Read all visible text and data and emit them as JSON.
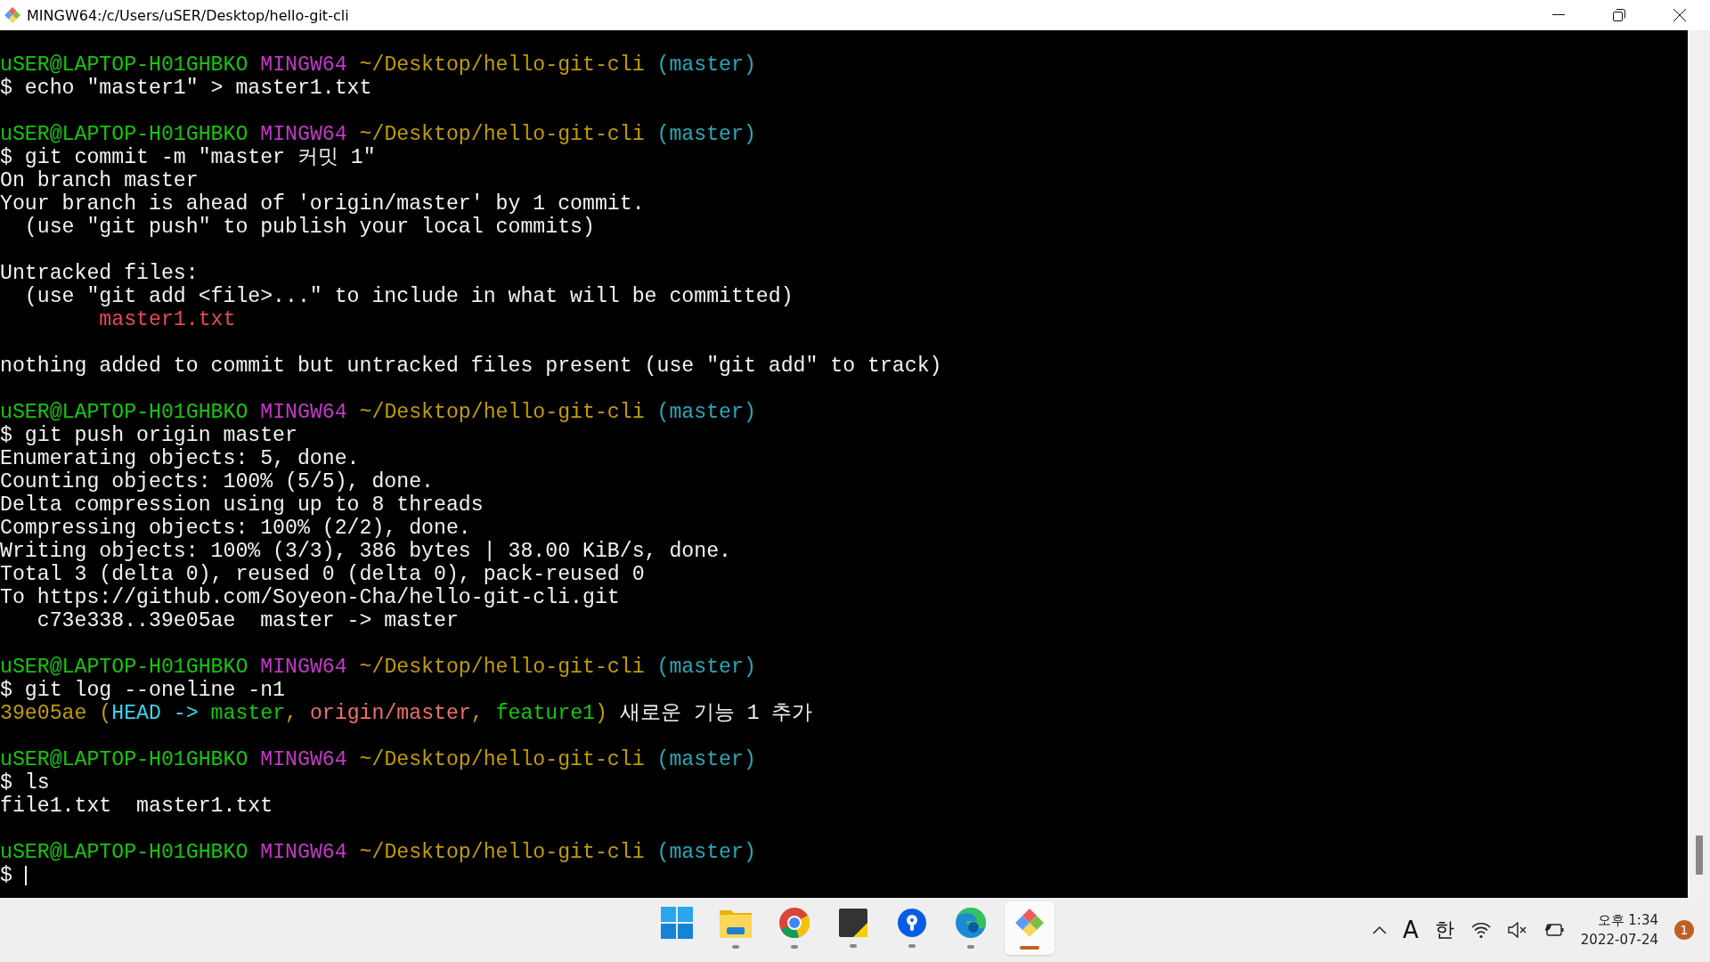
{
  "window": {
    "title": "MINGW64:/c/Users/uSER/Desktop/hello-git-cli"
  },
  "terminal": {
    "lines": [
      {
        "kind": "text",
        "segments": [
          {
            "text": "uSER@LAPTOP-H01GHBKO ",
            "color": "#16c60c"
          },
          {
            "text": "MINGW64 ",
            "color": "#c239c6"
          },
          {
            "text": "~/Desktop/hello-git-cli ",
            "color": "#c19c00"
          },
          {
            "text": "(master)",
            "color": "#2aa8b8"
          }
        ]
      },
      {
        "kind": "text",
        "segments": [
          {
            "text": "$ echo \"master1\" > master1.txt",
            "color": "#f2f2f2"
          }
        ]
      },
      {
        "kind": "blank"
      },
      {
        "kind": "text",
        "segments": [
          {
            "text": "uSER@LAPTOP-H01GHBKO ",
            "color": "#16c60c"
          },
          {
            "text": "MINGW64 ",
            "color": "#c239c6"
          },
          {
            "text": "~/Desktop/hello-git-cli ",
            "color": "#c19c00"
          },
          {
            "text": "(master)",
            "color": "#2aa8b8"
          }
        ]
      },
      {
        "kind": "text",
        "segments": [
          {
            "text": "$ git commit -m \"master 커밋 1\"",
            "color": "#f2f2f2"
          }
        ]
      },
      {
        "kind": "text",
        "segments": [
          {
            "text": "On branch master",
            "color": "#f2f2f2"
          }
        ]
      },
      {
        "kind": "text",
        "segments": [
          {
            "text": "Your branch is ahead of 'origin/master' by 1 commit.",
            "color": "#f2f2f2"
          }
        ]
      },
      {
        "kind": "text",
        "segments": [
          {
            "text": "  (use \"git push\" to publish your local commits)",
            "color": "#f2f2f2"
          }
        ]
      },
      {
        "kind": "blank"
      },
      {
        "kind": "text",
        "segments": [
          {
            "text": "Untracked files:",
            "color": "#f2f2f2"
          }
        ]
      },
      {
        "kind": "text",
        "segments": [
          {
            "text": "  (use \"git add <file>...\" to include in what will be committed)",
            "color": "#f2f2f2"
          }
        ]
      },
      {
        "kind": "text",
        "segments": [
          {
            "text": "        master1.txt",
            "color": "#e74856"
          }
        ]
      },
      {
        "kind": "blank"
      },
      {
        "kind": "text",
        "segments": [
          {
            "text": "nothing added to commit but untracked files present (use \"git add\" to track)",
            "color": "#f2f2f2"
          }
        ]
      },
      {
        "kind": "blank"
      },
      {
        "kind": "text",
        "segments": [
          {
            "text": "uSER@LAPTOP-H01GHBKO ",
            "color": "#16c60c"
          },
          {
            "text": "MINGW64 ",
            "color": "#c239c6"
          },
          {
            "text": "~/Desktop/hello-git-cli ",
            "color": "#c19c00"
          },
          {
            "text": "(master)",
            "color": "#2aa8b8"
          }
        ]
      },
      {
        "kind": "text",
        "segments": [
          {
            "text": "$ git push origin master",
            "color": "#f2f2f2"
          }
        ]
      },
      {
        "kind": "text",
        "segments": [
          {
            "text": "Enumerating objects: 5, done.",
            "color": "#f2f2f2"
          }
        ]
      },
      {
        "kind": "text",
        "segments": [
          {
            "text": "Counting objects: 100% (5/5), done.",
            "color": "#f2f2f2"
          }
        ]
      },
      {
        "kind": "text",
        "segments": [
          {
            "text": "Delta compression using up to 8 threads",
            "color": "#f2f2f2"
          }
        ]
      },
      {
        "kind": "text",
        "segments": [
          {
            "text": "Compressing objects: 100% (2/2), done.",
            "color": "#f2f2f2"
          }
        ]
      },
      {
        "kind": "text",
        "segments": [
          {
            "text": "Writing objects: 100% (3/3), 386 bytes | 38.00 KiB/s, done.",
            "color": "#f2f2f2"
          }
        ]
      },
      {
        "kind": "text",
        "segments": [
          {
            "text": "Total 3 (delta 0), reused 0 (delta 0), pack-reused 0",
            "color": "#f2f2f2"
          }
        ]
      },
      {
        "kind": "text",
        "segments": [
          {
            "text": "To https://github.com/Soyeon-Cha/hello-git-cli.git",
            "color": "#f2f2f2"
          }
        ]
      },
      {
        "kind": "text",
        "segments": [
          {
            "text": "   c73e338..39e05ae  master -> master",
            "color": "#f2f2f2"
          }
        ]
      },
      {
        "kind": "blank"
      },
      {
        "kind": "text",
        "segments": [
          {
            "text": "uSER@LAPTOP-H01GHBKO ",
            "color": "#16c60c"
          },
          {
            "text": "MINGW64 ",
            "color": "#c239c6"
          },
          {
            "text": "~/Desktop/hello-git-cli ",
            "color": "#c19c00"
          },
          {
            "text": "(master)",
            "color": "#2aa8b8"
          }
        ]
      },
      {
        "kind": "text",
        "segments": [
          {
            "text": "$ git log --oneline -n1",
            "color": "#f2f2f2"
          }
        ]
      },
      {
        "kind": "text",
        "segments": [
          {
            "text": "39e05ae ",
            "color": "#c19c00"
          },
          {
            "text": "(",
            "color": "#c19c00"
          },
          {
            "text": "HEAD -> ",
            "color": "#3ad6f0"
          },
          {
            "text": "master",
            "color": "#16c60c"
          },
          {
            "text": ", ",
            "color": "#c19c00"
          },
          {
            "text": "origin/master",
            "color": "#f26d6d"
          },
          {
            "text": ", ",
            "color": "#c19c00"
          },
          {
            "text": "feature1",
            "color": "#16c60c"
          },
          {
            "text": ")",
            "color": "#c19c00"
          },
          {
            "text": " 새로운 기능 1 추가",
            "color": "#f2f2f2"
          }
        ]
      },
      {
        "kind": "blank"
      },
      {
        "kind": "text",
        "segments": [
          {
            "text": "uSER@LAPTOP-H01GHBKO ",
            "color": "#16c60c"
          },
          {
            "text": "MINGW64 ",
            "color": "#c239c6"
          },
          {
            "text": "~/Desktop/hello-git-cli ",
            "color": "#c19c00"
          },
          {
            "text": "(master)",
            "color": "#2aa8b8"
          }
        ]
      },
      {
        "kind": "text",
        "segments": [
          {
            "text": "$ ls",
            "color": "#f2f2f2"
          }
        ]
      },
      {
        "kind": "text",
        "segments": [
          {
            "text": "file1.txt  master1.txt",
            "color": "#f2f2f2"
          }
        ]
      },
      {
        "kind": "blank"
      },
      {
        "kind": "text",
        "segments": [
          {
            "text": "uSER@LAPTOP-H01GHBKO ",
            "color": "#16c60c"
          },
          {
            "text": "MINGW64 ",
            "color": "#c239c6"
          },
          {
            "text": "~/Desktop/hello-git-cli ",
            "color": "#c19c00"
          },
          {
            "text": "(master)",
            "color": "#2aa8b8"
          }
        ]
      },
      {
        "kind": "input",
        "segments": [
          {
            "text": "$ ",
            "color": "#f2f2f2"
          }
        ]
      }
    ]
  },
  "taskbar": {
    "apps": [
      {
        "kind": "start",
        "selected": false
      },
      {
        "kind": "folder",
        "selected": false
      },
      {
        "kind": "chrome",
        "selected": false
      },
      {
        "kind": "notes",
        "selected": false
      },
      {
        "kind": "pin",
        "selected": false
      },
      {
        "kind": "edge",
        "selected": false
      },
      {
        "kind": "git",
        "selected": true
      }
    ],
    "input_mode": "A",
    "ime": "한",
    "time": "오후 1:34",
    "date": "2022-07-24",
    "notification_count": "1"
  }
}
